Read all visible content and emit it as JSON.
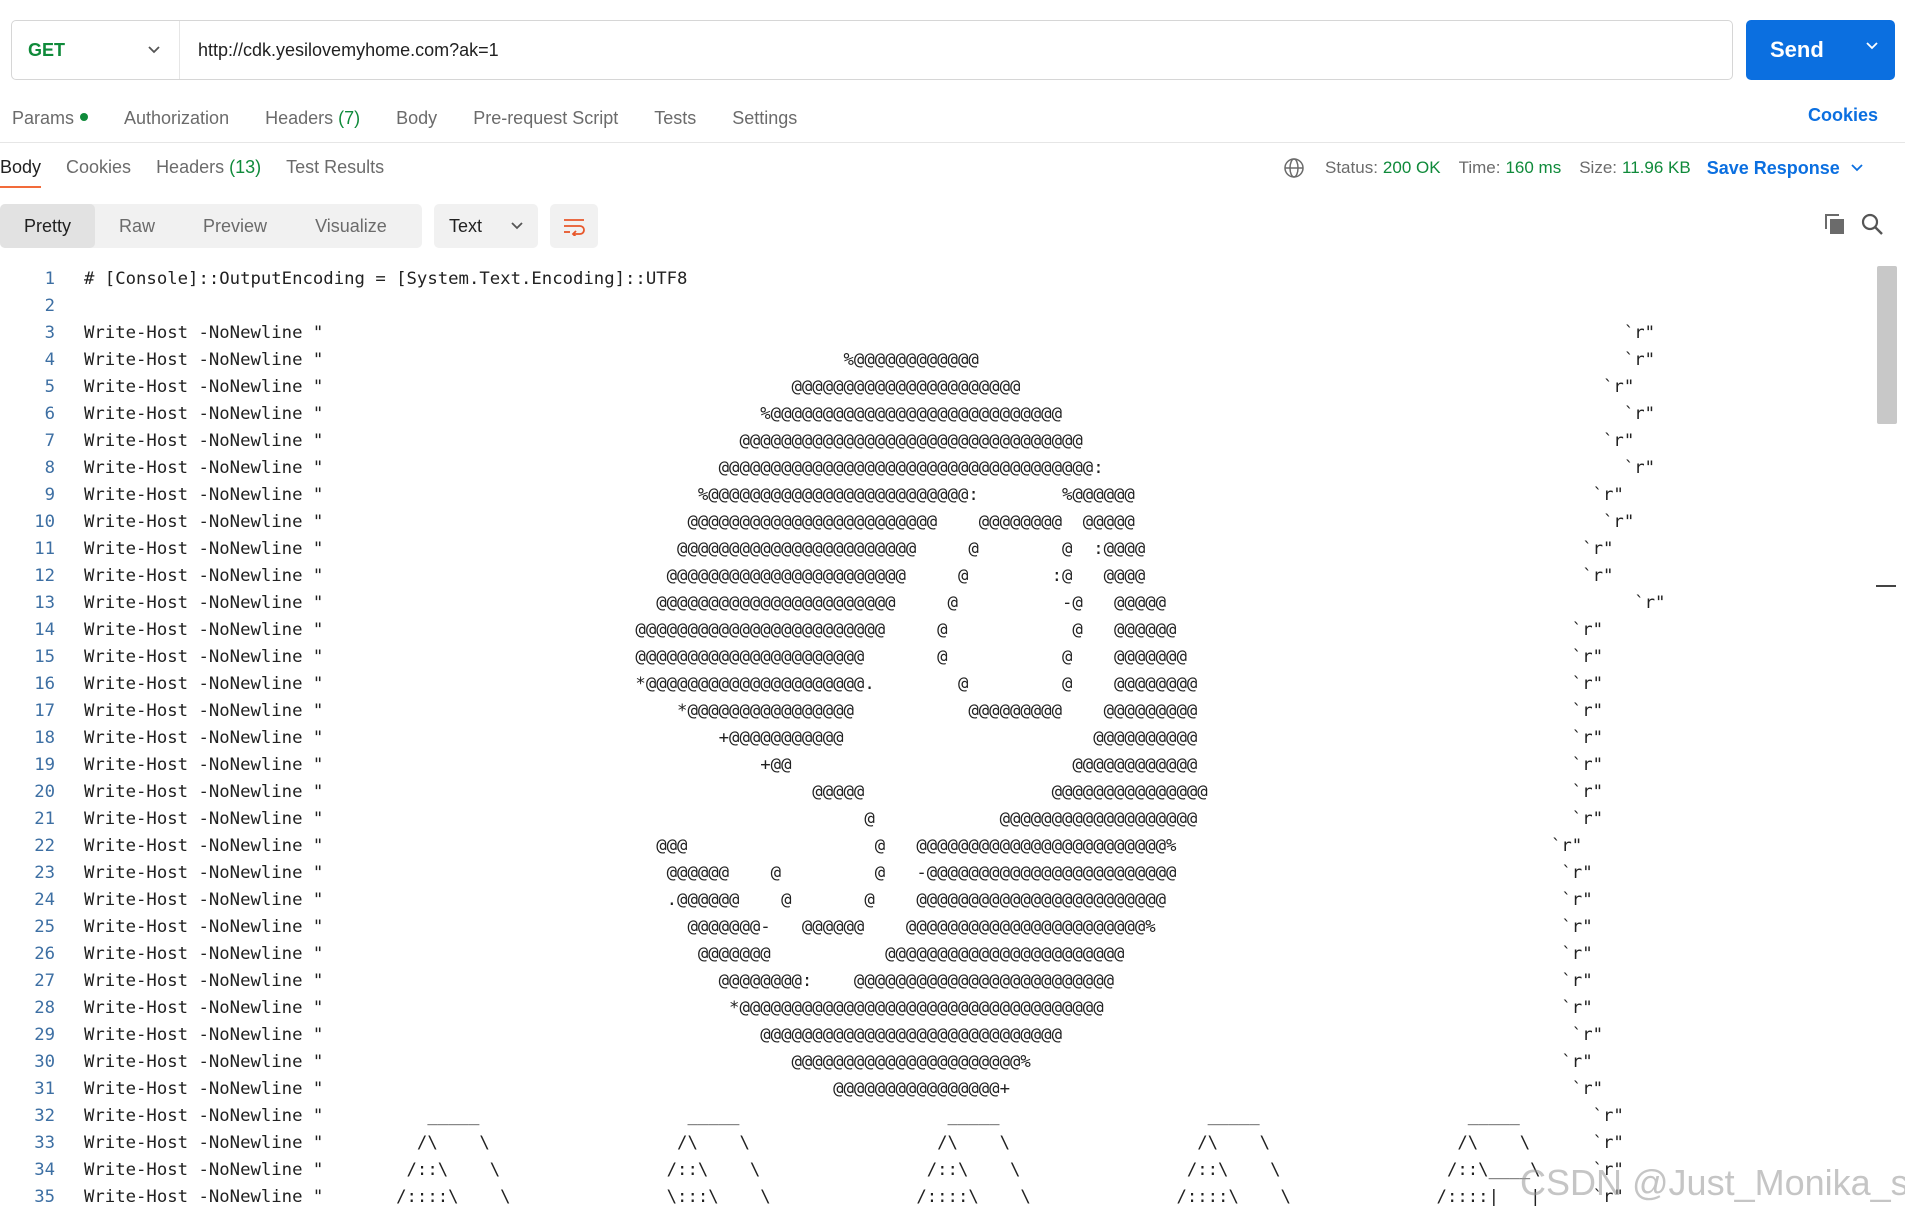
{
  "request": {
    "method": "GET",
    "url": "http://cdk.yesilovemyhome.com?ak=1",
    "send_label": "Send"
  },
  "request_tabs": {
    "params": "Params",
    "authorization": "Authorization",
    "headers": "Headers",
    "headers_count": "(7)",
    "body": "Body",
    "pre_request": "Pre-request Script",
    "tests": "Tests",
    "settings": "Settings",
    "cookies": "Cookies"
  },
  "response_tabs": {
    "body": "Body",
    "cookies": "Cookies",
    "headers": "Headers",
    "headers_count": "(13)",
    "test_results": "Test Results"
  },
  "status": {
    "status_label": "Status:",
    "status_value": "200 OK",
    "time_label": "Time:",
    "time_value": "160 ms",
    "size_label": "Size:",
    "size_value": "11.96 KB",
    "save_response": "Save Response"
  },
  "view": {
    "pretty": "Pretty",
    "raw": "Raw",
    "preview": "Preview",
    "visualize": "Visualize",
    "format": "Text"
  },
  "icons": {
    "method_caret": "chevron-down-icon",
    "send_caret": "chevron-down-icon",
    "globe": "globe-icon",
    "wrap": "wrap-lines-icon",
    "copy": "copy-icon",
    "search": "search-icon"
  },
  "colors": {
    "send_button": "#0b6fe0",
    "method_text": "#0f8a3a",
    "status_value": "#0f8a3a",
    "active_tab_underline": "#f26b3a",
    "line_numbers": "#3d6fa3"
  },
  "code_lines": [
    {
      "n": "1",
      "text": "# [Console]::OutputEncoding = [System.Text.Encoding]::UTF8"
    },
    {
      "n": "2",
      "text": ""
    },
    {
      "n": "3",
      "text": "Write-Host -NoNewline \"                                                                                                                             `r\""
    },
    {
      "n": "4",
      "text": "Write-Host -NoNewline \"                                                  %@@@@@@@@@@@@                                                              `r\""
    },
    {
      "n": "5",
      "text": "Write-Host -NoNewline \"                                             @@@@@@@@@@@@@@@@@@@@@@                                                        `r\""
    },
    {
      "n": "6",
      "text": "Write-Host -NoNewline \"                                          %@@@@@@@@@@@@@@@@@@@@@@@@@@@@                                                      `r\""
    },
    {
      "n": "7",
      "text": "Write-Host -NoNewline \"                                        @@@@@@@@@@@@@@@@@@@@@@@@@@@@@@@@@                                                  `r\""
    },
    {
      "n": "8",
      "text": "Write-Host -NoNewline \"                                      @@@@@@@@@@@@@@@@@@@@@@@@@@@@@@@@@@@@:                                                  `r\""
    },
    {
      "n": "9",
      "text": "Write-Host -NoNewline \"                                    %@@@@@@@@@@@@@@@@@@@@@@@@@:        %@@@@@@                                            `r\""
    },
    {
      "n": "10",
      "text": "Write-Host -NoNewline \"                                   @@@@@@@@@@@@@@@@@@@@@@@@    @@@@@@@@  @@@@@                                             `r\""
    },
    {
      "n": "11",
      "text": "Write-Host -NoNewline \"                                  @@@@@@@@@@@@@@@@@@@@@@@     @        @  :@@@@                                          `r\""
    },
    {
      "n": "12",
      "text": "Write-Host -NoNewline \"                                 @@@@@@@@@@@@@@@@@@@@@@@     @        :@   @@@@                                          `r\""
    },
    {
      "n": "13",
      "text": "Write-Host -NoNewline \"                                @@@@@@@@@@@@@@@@@@@@@@@     @          -@   @@@@@                                             `r\""
    },
    {
      "n": "14",
      "text": "Write-Host -NoNewline \"                              @@@@@@@@@@@@@@@@@@@@@@@@     @            @   @@@@@@                                      `r\""
    },
    {
      "n": "15",
      "text": "Write-Host -NoNewline \"                              @@@@@@@@@@@@@@@@@@@@@@       @           @    @@@@@@@                                     `r\""
    },
    {
      "n": "16",
      "text": "Write-Host -NoNewline \"                              *@@@@@@@@@@@@@@@@@@@@@.        @         @    @@@@@@@@                                    `r\""
    },
    {
      "n": "17",
      "text": "Write-Host -NoNewline \"                                  *@@@@@@@@@@@@@@@@           @@@@@@@@@    @@@@@@@@@                                    `r\""
    },
    {
      "n": "18",
      "text": "Write-Host -NoNewline \"                                      +@@@@@@@@@@@                        @@@@@@@@@@                                    `r\""
    },
    {
      "n": "19",
      "text": "Write-Host -NoNewline \"                                          +@@                           @@@@@@@@@@@@                                    `r\""
    },
    {
      "n": "20",
      "text": "Write-Host -NoNewline \"                                               @@@@@                  @@@@@@@@@@@@@@@                                   `r\""
    },
    {
      "n": "21",
      "text": "Write-Host -NoNewline \"                                                    @            @@@@@@@@@@@@@@@@@@@                                    `r\""
    },
    {
      "n": "22",
      "text": "Write-Host -NoNewline \"                                @@@                  @   @@@@@@@@@@@@@@@@@@@@@@@@%                                    `r\""
    },
    {
      "n": "23",
      "text": "Write-Host -NoNewline \"                                 @@@@@@    @         @   -@@@@@@@@@@@@@@@@@@@@@@@@                                     `r\""
    },
    {
      "n": "24",
      "text": "Write-Host -NoNewline \"                                 .@@@@@@    @       @    @@@@@@@@@@@@@@@@@@@@@@@@                                      `r\""
    },
    {
      "n": "25",
      "text": "Write-Host -NoNewline \"                                   @@@@@@@-   @@@@@@    @@@@@@@@@@@@@@@@@@@@@@@%                                       `r\""
    },
    {
      "n": "26",
      "text": "Write-Host -NoNewline \"                                    @@@@@@@           @@@@@@@@@@@@@@@@@@@@@@@                                          `r\""
    },
    {
      "n": "27",
      "text": "Write-Host -NoNewline \"                                      @@@@@@@@:    @@@@@@@@@@@@@@@@@@@@@@@@@                                           `r\""
    },
    {
      "n": "28",
      "text": "Write-Host -NoNewline \"                                       *@@@@@@@@@@@@@@@@@@@@@@@@@@@@@@@@@@@                                            `r\""
    },
    {
      "n": "29",
      "text": "Write-Host -NoNewline \"                                          @@@@@@@@@@@@@@@@@@@@@@@@@@@@@                                                 `r\""
    },
    {
      "n": "30",
      "text": "Write-Host -NoNewline \"                                             @@@@@@@@@@@@@@@@@@@@@@%                                                   `r\""
    },
    {
      "n": "31",
      "text": "Write-Host -NoNewline \"                                                 @@@@@@@@@@@@@@@@+                                                      `r\""
    },
    {
      "n": "32",
      "text": "Write-Host -NoNewline \"          _____                    _____                    _____                    _____                    _____       `r\""
    },
    {
      "n": "33",
      "text": "Write-Host -NoNewline \"         /\\    \\                  /\\    \\                  /\\    \\                  /\\    \\                  /\\    \\      `r\""
    },
    {
      "n": "34",
      "text": "Write-Host -NoNewline \"        /::\\    \\                /::\\    \\                /::\\    \\                /::\\    \\                /::\\____\\     `r\""
    },
    {
      "n": "35",
      "text": "Write-Host -NoNewline \"       /::::\\    \\               \\:::\\    \\              /::::\\    \\              /::::\\    \\              /::::|   |     `r\""
    }
  ],
  "watermark": "CSDN @Just_Monika_s"
}
